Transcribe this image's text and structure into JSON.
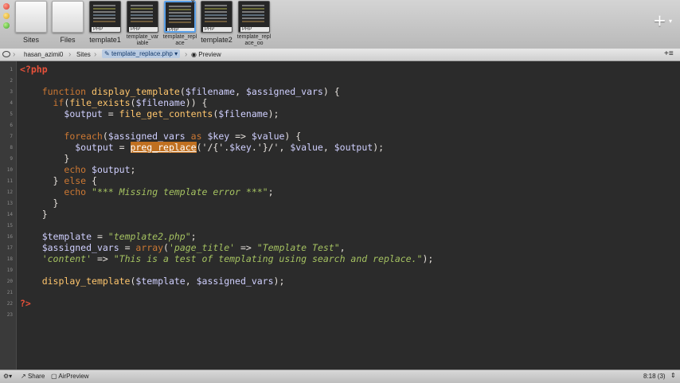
{
  "tabs": [
    {
      "label": "Sites",
      "style": "light"
    },
    {
      "label": "Files",
      "style": "light"
    },
    {
      "label": "template1",
      "style": "dark",
      "badge": "PHP"
    },
    {
      "label": "template_variable",
      "style": "dark",
      "badge": "PHP"
    },
    {
      "label": "template_replace",
      "style": "dark",
      "badge": "PHP",
      "selected": true
    },
    {
      "label": "template2",
      "style": "dark",
      "badge": "PHP"
    },
    {
      "label": "template_replace_oo",
      "style": "dark",
      "badge": "PHP"
    }
  ],
  "tab_labels": {
    "sites": "Sites",
    "files": "Files",
    "template1": "template1",
    "template_variable_a": "template_var",
    "template_variable_b": "iable",
    "template_replace_a": "template_repl",
    "template_replace_b": "ace",
    "template2": "template2",
    "template_replace_oo_a": "template_repl",
    "template_replace_oo_b": "ace_oo",
    "badge": "PHP"
  },
  "new_tab_plus": "+",
  "pathbar": {
    "user": "hasan_azimi0",
    "sites": "Sites",
    "file": "template_replace.php",
    "preview": "Preview"
  },
  "line_numbers": [
    "1",
    "2",
    "3",
    "4",
    "5",
    "6",
    "7",
    "8",
    "9",
    "10",
    "11",
    "12",
    "13",
    "14",
    "15",
    "16",
    "17",
    "18",
    "19",
    "20",
    "21",
    "22",
    "23"
  ],
  "code": {
    "open_tag": "<?php",
    "close_tag": "?>",
    "kw_function": "function",
    "fn_display_template": "display_template",
    "param_filename": "$filename",
    "param_assigned_vars": "$assigned_vars",
    "kw_if": "if",
    "fn_file_exists": "file_exists",
    "var_output": "$output",
    "fn_file_get_contents": "file_get_contents",
    "kw_foreach": "foreach",
    "kw_as": "as",
    "var_key": "$key",
    "var_value": "$value",
    "fn_preg_replace": "preg_replace",
    "kw_echo": "echo",
    "kw_else": "else",
    "str_missing": "\"*** Missing template error ***\"",
    "var_template": "$template",
    "str_template2": "\"template2.php\"",
    "fn_array": "array",
    "str_page_title": "'page_title'",
    "str_template_test": "\"Template Test\"",
    "str_content": "'content'",
    "str_this_is": "\"This is a test of templating using search and replace.\"",
    "line8_middle": "('/{'.",
    "line8_tail": ".'}/', ",
    "line8_end": ");"
  },
  "status": {
    "share": "Share",
    "airpreview": "AirPreview",
    "position": "8:18 (3)"
  },
  "colors": {
    "editor_bg": "#2b2b2b",
    "keyword": "#cc7833",
    "string": "#a5c261",
    "function": "#ffc66d",
    "variable": "#d0d0ff",
    "php_tag": "#e8513a",
    "highlight": "#c07020"
  }
}
